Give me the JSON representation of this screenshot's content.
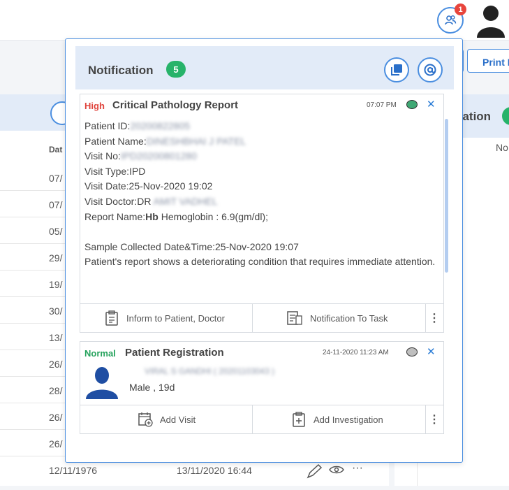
{
  "header": {
    "notification_count": "1",
    "print_label": "Print I"
  },
  "background": {
    "col_label": "Dat",
    "rows": [
      "07/",
      "07/",
      "05/",
      "29/",
      "19/",
      "30/",
      "13/",
      "26/",
      "28/",
      "26/",
      "26/"
    ],
    "last_row": {
      "date": "12/11/1976",
      "datetime": "13/11/2020 16:44"
    },
    "right_panel_title": "cation",
    "right_panel_text": "No"
  },
  "popup": {
    "title": "Notification",
    "count": "5",
    "cards": [
      {
        "priority": "High",
        "priority_color": "#e0443c",
        "title": "Critical Pathology Report",
        "time": "07:07 PM",
        "dot_color": "#3fa874",
        "patient_id_label": "Patient ID:",
        "patient_id_value": "20200822805",
        "patient_name_label": "Patient Name:",
        "patient_name_value": "DINESHBHAI J PATEL",
        "visit_no_label": "Visit No:",
        "visit_no_value": "IPD20200801280",
        "visit_type": "Visit Type:IPD",
        "visit_date": "Visit Date:25-Nov-2020 19:02",
        "visit_doctor_label": "Visit Doctor:DR",
        "visit_doctor_value": "AMIT VADHEL",
        "report_name_label": "Report Name:",
        "report_name_bold": "Hb",
        "report_name_rest": " Hemoglobin : 6.9(gm/dl);",
        "sample_collected": "Sample Collected Date&Time:25-Nov-2020 19:07",
        "message": "Patient's report shows a deteriorating condition that requires immediate attention.",
        "action1": "Inform to Patient, Doctor",
        "action2": "Notification To Task"
      },
      {
        "priority": "Normal",
        "priority_color": "#27a35e",
        "title": "Patient Registration",
        "time": "24-11-2020 11:23 AM",
        "dot_color": "#bfbfbf",
        "patient_name": "VIRAL S GANDHI ( 20201103043 )",
        "gender_age": "Male , 19d",
        "action1": "Add Visit",
        "action2": "Add Investigation"
      }
    ]
  }
}
